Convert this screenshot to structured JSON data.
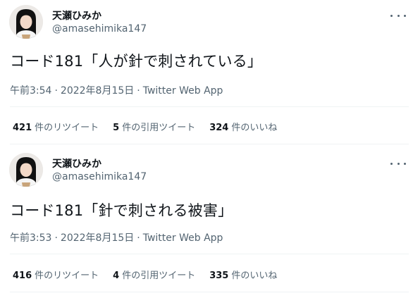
{
  "tweets": [
    {
      "author_name": "天瀬ひみか",
      "author_handle": "@amasehimika147",
      "text": "コード181「人が針で刺されている」",
      "time": "午前3:54",
      "date": "2022年8月15日",
      "source": "Twitter Web App",
      "separator": "·",
      "retweets": "421",
      "retweets_label": "件のリツイート",
      "quotes": "5",
      "quotes_label": "件の引用ツイート",
      "likes": "324",
      "likes_label": "件のいいね"
    },
    {
      "author_name": "天瀬ひみか",
      "author_handle": "@amasehimika147",
      "text": "コード181「針で刺される被害」",
      "time": "午前3:53",
      "date": "2022年8月15日",
      "source": "Twitter Web App",
      "separator": "·",
      "retweets": "416",
      "retweets_label": "件のリツイート",
      "quotes": "4",
      "quotes_label": "件の引用ツイート",
      "likes": "335",
      "likes_label": "件のいいね"
    }
  ],
  "colors": {
    "text_primary": "#0f1419",
    "text_secondary": "#536471",
    "divider": "#eff3f4"
  },
  "icons": {
    "more": "more-horizontal-icon",
    "avatar": "profile-photo"
  }
}
